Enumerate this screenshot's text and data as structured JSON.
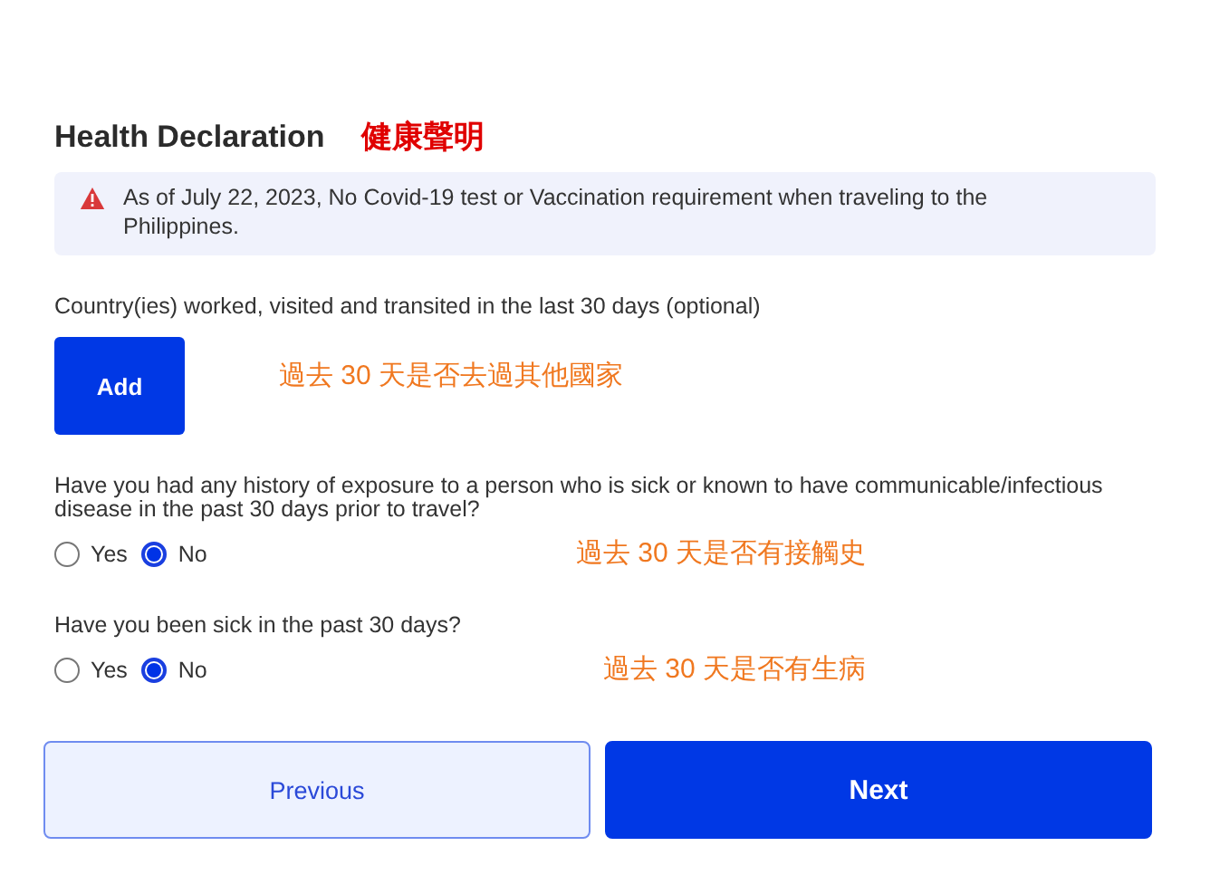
{
  "title": "Health Declaration",
  "title_note": "健康聲明",
  "alert": {
    "text": "As of July 22, 2023, No Covid-19 test or Vaccination requirement when traveling to the Philippines."
  },
  "countries": {
    "label": "Country(ies) worked, visited and transited in the last 30 days (optional)",
    "button": "Add",
    "note": "過去 30 天是否去過其他國家"
  },
  "questions": [
    {
      "text": "Have you had any history of exposure to a person who is sick or known to have communicable/infectious disease in the past 30 days prior to travel?",
      "note": "過去 30 天是否有接觸史",
      "options": [
        {
          "label": "Yes",
          "selected": false
        },
        {
          "label": "No",
          "selected": true
        }
      ]
    },
    {
      "text": "Have you been sick in the past 30 days?",
      "note": "過去 30 天是否有生病",
      "options": [
        {
          "label": "Yes",
          "selected": false
        },
        {
          "label": "No",
          "selected": true
        }
      ]
    }
  ],
  "buttons": [
    {
      "label": "Previous",
      "kind": "secondary"
    },
    {
      "label": "Next",
      "kind": "primary"
    }
  ]
}
